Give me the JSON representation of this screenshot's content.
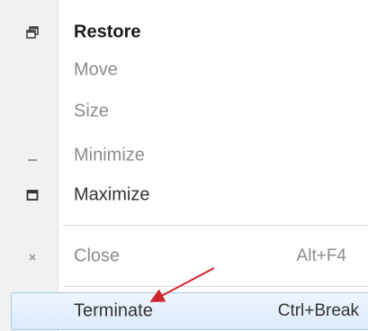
{
  "menu": {
    "items": [
      {
        "label": "Restore",
        "shortcut": "",
        "icon": "restore-icon",
        "state": "bold"
      },
      {
        "label": "Move",
        "shortcut": "",
        "icon": "",
        "state": "disabled"
      },
      {
        "label": "Size",
        "shortcut": "",
        "icon": "",
        "state": "disabled"
      },
      {
        "label": "Minimize",
        "shortcut": "",
        "icon": "minimize-icon",
        "state": "disabled"
      },
      {
        "label": "Maximize",
        "shortcut": "",
        "icon": "maximize-icon",
        "state": "enabled"
      },
      {
        "label": "Close",
        "shortcut": "Alt+F4",
        "icon": "close-icon",
        "state": "disabled"
      },
      {
        "label": "Terminate",
        "shortcut": "Ctrl+Break",
        "icon": "",
        "state": "highlighted"
      }
    ],
    "colors": {
      "highlight_border": "#a6c9ea",
      "highlight_fill": "#dcebfc",
      "annotation_arrow": "#d0262b",
      "disabled_text": "#8c8c8c"
    }
  }
}
